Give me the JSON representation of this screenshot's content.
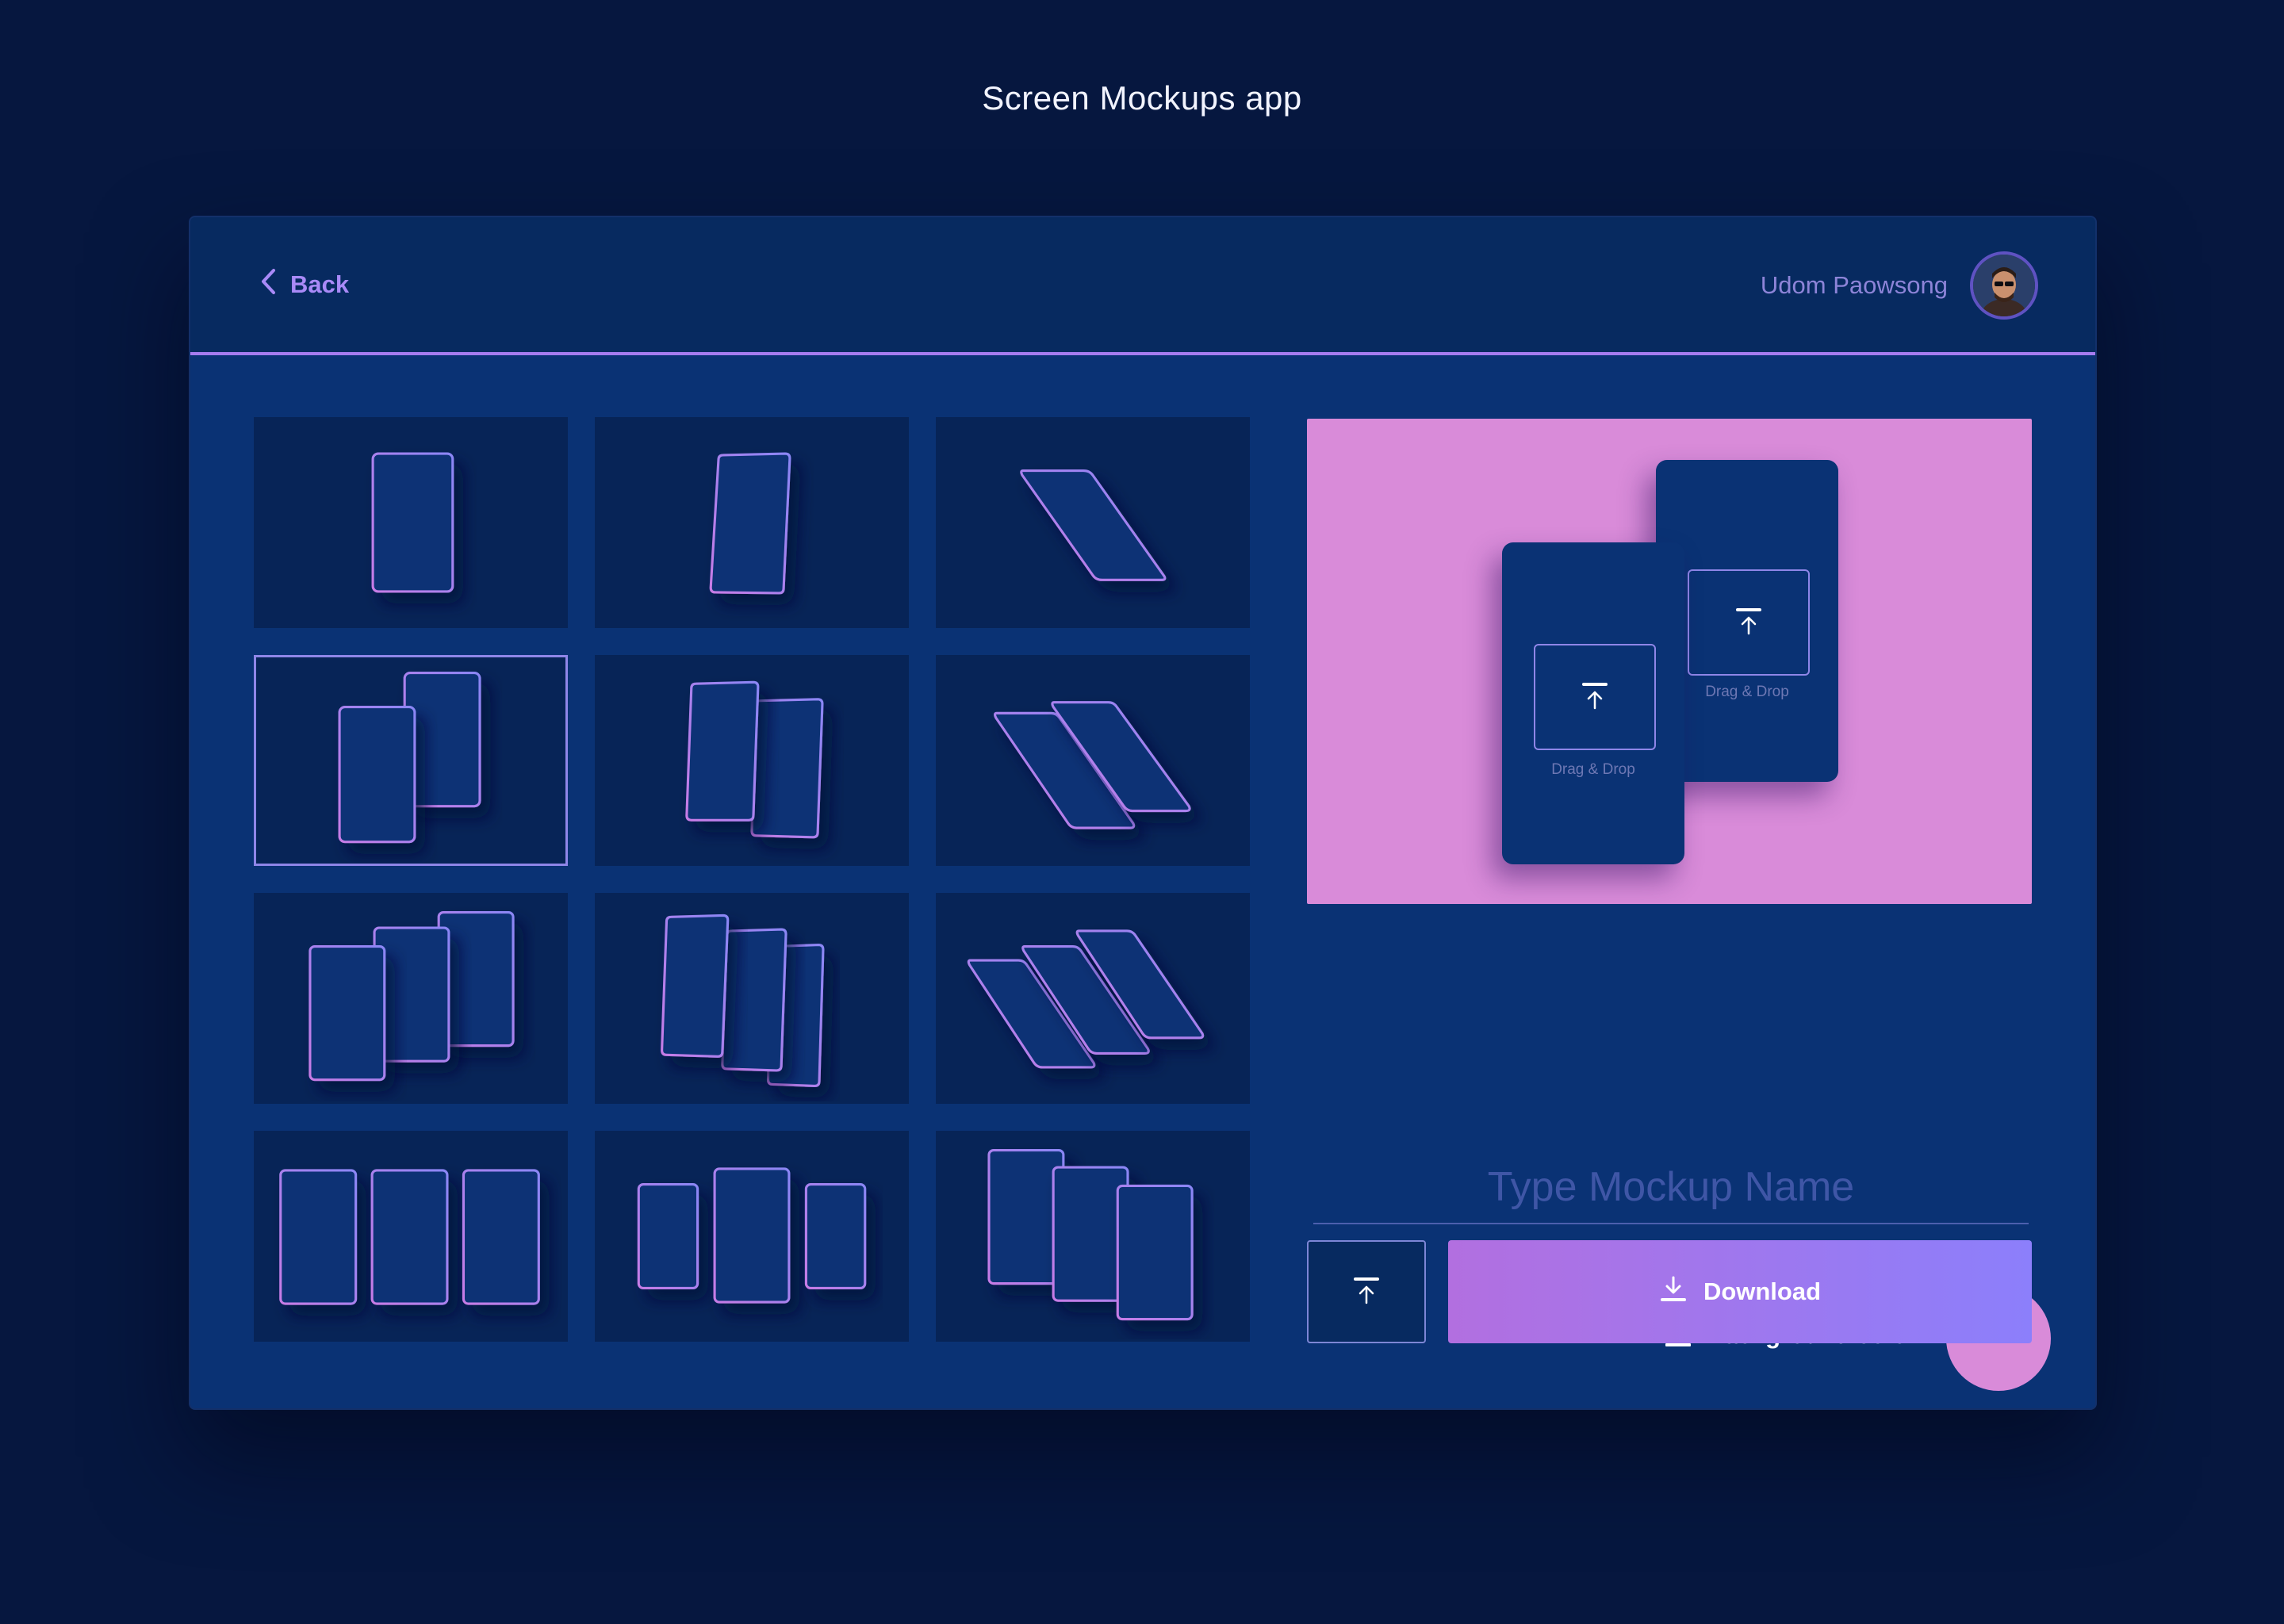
{
  "page": {
    "title": "Screen Mockups app"
  },
  "header": {
    "back_label": "Back",
    "user_name": "Udom Paowsong"
  },
  "thumbnails": [
    {
      "name": "single-portrait"
    },
    {
      "name": "single-tilted"
    },
    {
      "name": "single-flat"
    },
    {
      "name": "double-stacked",
      "selected": true
    },
    {
      "name": "double-tilted"
    },
    {
      "name": "double-flat"
    },
    {
      "name": "triple-stacked"
    },
    {
      "name": "triple-tilted"
    },
    {
      "name": "triple-flat"
    },
    {
      "name": "triple-row"
    },
    {
      "name": "triple-center-large"
    },
    {
      "name": "triple-cascade"
    }
  ],
  "preview": {
    "background": "#d98bd9",
    "dropzones": [
      {
        "label": "Drag & Drop"
      },
      {
        "label": "Drag & Drop"
      }
    ]
  },
  "form": {
    "name_placeholder": "Type Mockup Name",
    "name_value": "",
    "background_label": "Background color",
    "background_color": "#d98bd9"
  },
  "actions": {
    "download_label": "Download"
  },
  "colors": {
    "page_bg": "#06173f",
    "panel_bg": "#0a3274",
    "header_bg": "#072a60",
    "accent": "#a67cf0",
    "download_gradient": [
      "#b26fe0",
      "#8c7ffb"
    ]
  },
  "icons": {
    "back": "chevron-left-icon",
    "upload": "upload-icon",
    "download": "download-icon",
    "paint": "paint-bucket-icon"
  }
}
